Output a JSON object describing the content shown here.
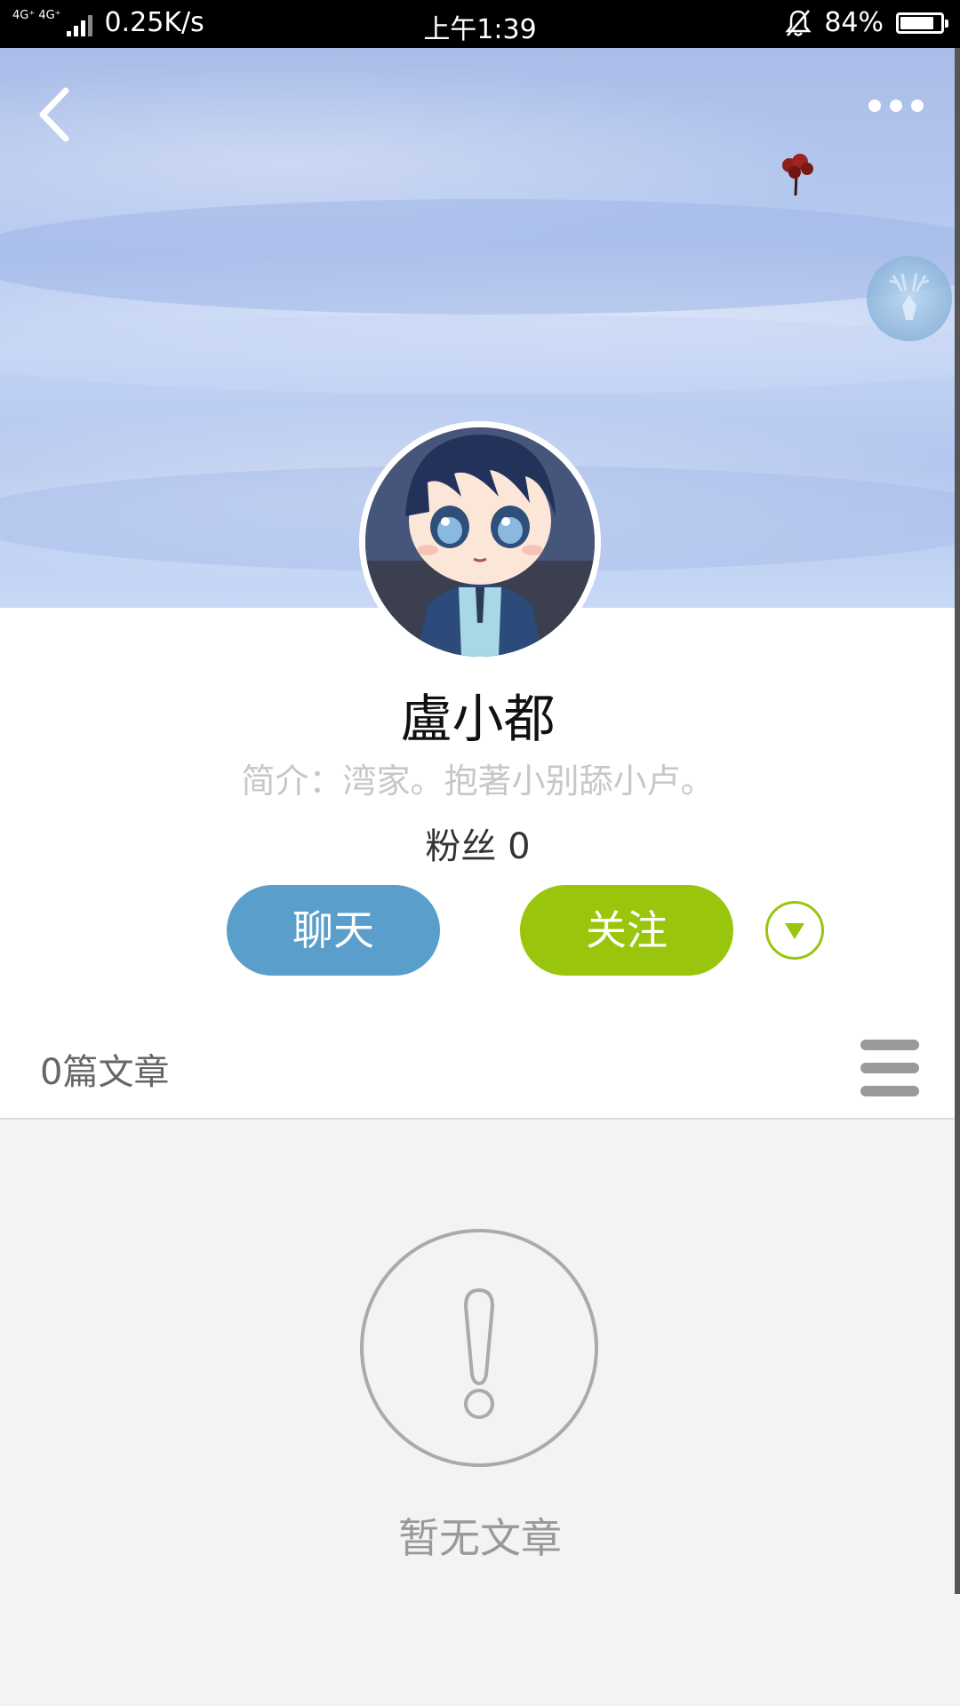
{
  "status_bar": {
    "network": "4G⁺ 4G⁺",
    "speed": "0.25K/s",
    "time": "上午1:39",
    "battery": "84%",
    "battery_level": 0.84
  },
  "header": {
    "back_icon": "chevron-left-icon",
    "more_icon": "more-dots-icon"
  },
  "profile": {
    "name": "盧小都",
    "bio": "简介：湾家。抱著小别舔小卢。",
    "fans": "粉丝 0"
  },
  "actions": {
    "chat_label": "聊天",
    "follow_label": "关注"
  },
  "articles": {
    "count_label": "0篇文章",
    "empty_label": "暂无文章"
  },
  "colors": {
    "chat": "#5a9fcb",
    "follow": "#99c50c",
    "banner": "#b5c8ef"
  }
}
